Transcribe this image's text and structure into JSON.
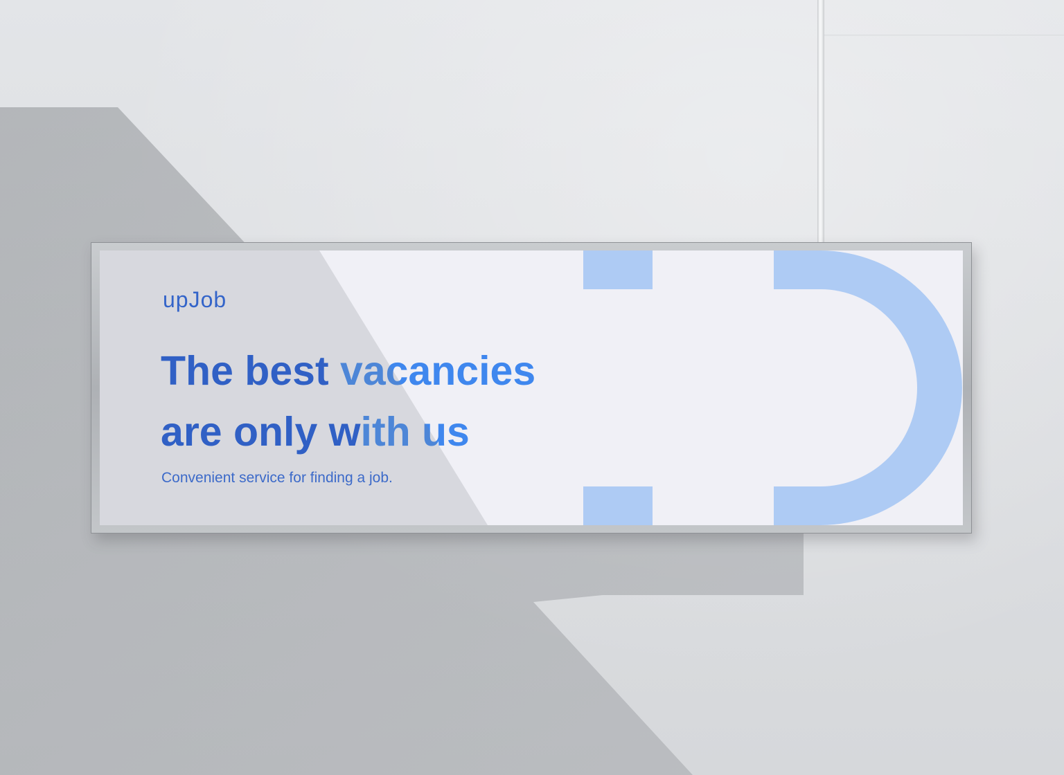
{
  "billboard": {
    "logo": "upJob",
    "headline": {
      "line1_dark": "The best",
      "line1_light": "vacancies",
      "line2_dark": "are only w",
      "line2_light": "ith us"
    },
    "tagline": "Convenient service for finding a job."
  },
  "colors": {
    "brand_blue": "#1a56d6",
    "accent_blue": "#3f87ee",
    "shape_blue": "#aecbf4",
    "poster_bg": "#f0f0f6",
    "wall": "#dcdee1"
  }
}
